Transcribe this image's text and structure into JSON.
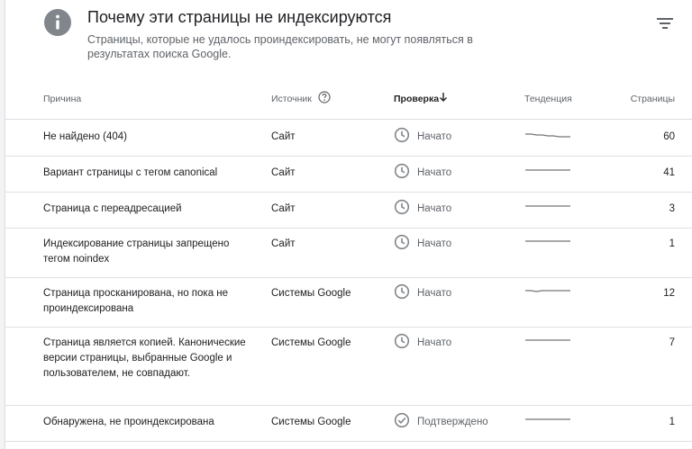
{
  "header": {
    "title": "Почему эти страницы не индексируются",
    "subtitle": "Страницы, которые не удалось проиндексировать, не могут появляться в результатах поиска Google.",
    "info_icon": "info-icon",
    "filter_icon": "filter-icon"
  },
  "table": {
    "columns": {
      "reason": "Причина",
      "source": "Источник",
      "check": "Проверка",
      "trend": "Тенденция",
      "pages": "Страницы"
    },
    "sort": {
      "column": "check",
      "direction": "descending"
    },
    "rows": [
      {
        "reason": "Не найдено (404)",
        "source": "Сайт",
        "status": "Начато",
        "status_icon": "clock-icon",
        "pages": "60",
        "trend": [
          60,
          60,
          59,
          59,
          58,
          58,
          57,
          57,
          57
        ]
      },
      {
        "reason": "Вариант страницы с тегом canonical",
        "source": "Сайт",
        "status": "Начато",
        "status_icon": "clock-icon",
        "pages": "41",
        "trend": [
          41,
          41,
          41,
          41,
          41,
          41,
          41,
          41,
          41
        ]
      },
      {
        "reason": "Страница с переадресацией",
        "source": "Сайт",
        "status": "Начато",
        "status_icon": "clock-icon",
        "pages": "3",
        "trend": [
          3,
          3,
          3,
          3,
          3,
          3,
          3,
          3,
          3
        ]
      },
      {
        "reason": "Индексирование страницы запрещено тегом noindex",
        "source": "Сайт",
        "status": "Начато",
        "status_icon": "clock-icon",
        "pages": "1",
        "trend": [
          1,
          1,
          1,
          1,
          1,
          1,
          1,
          1,
          1
        ]
      },
      {
        "reason": "Страница просканирована, но пока не проиндексирована",
        "source": "Системы Google",
        "status": "Начато",
        "status_icon": "clock-icon",
        "pages": "12",
        "trend": [
          12,
          12,
          11,
          12,
          12,
          12,
          12,
          12,
          12
        ]
      },
      {
        "reason": "Страница является копией. Канонические версии страницы, выбранные Google и пользователем, не совпадают.",
        "source": "Системы Google",
        "status": "Начато",
        "status_icon": "clock-icon",
        "pages": "7",
        "trend": [
          7,
          7,
          7,
          7,
          7,
          7,
          7,
          7,
          7
        ]
      },
      {
        "reason": "Обнаружена, не проиндексирована",
        "source": "Системы Google",
        "status": "Подтверждено",
        "status_icon": "check-circle-icon",
        "pages": "1",
        "trend": [
          1,
          1,
          1,
          1,
          1,
          1,
          1,
          1,
          1
        ]
      }
    ]
  },
  "colors": {
    "text": "#202124",
    "muted": "#5f6368",
    "icon_gray": "#80868b",
    "sparkline": "#757575",
    "divider": "#dadce0"
  }
}
